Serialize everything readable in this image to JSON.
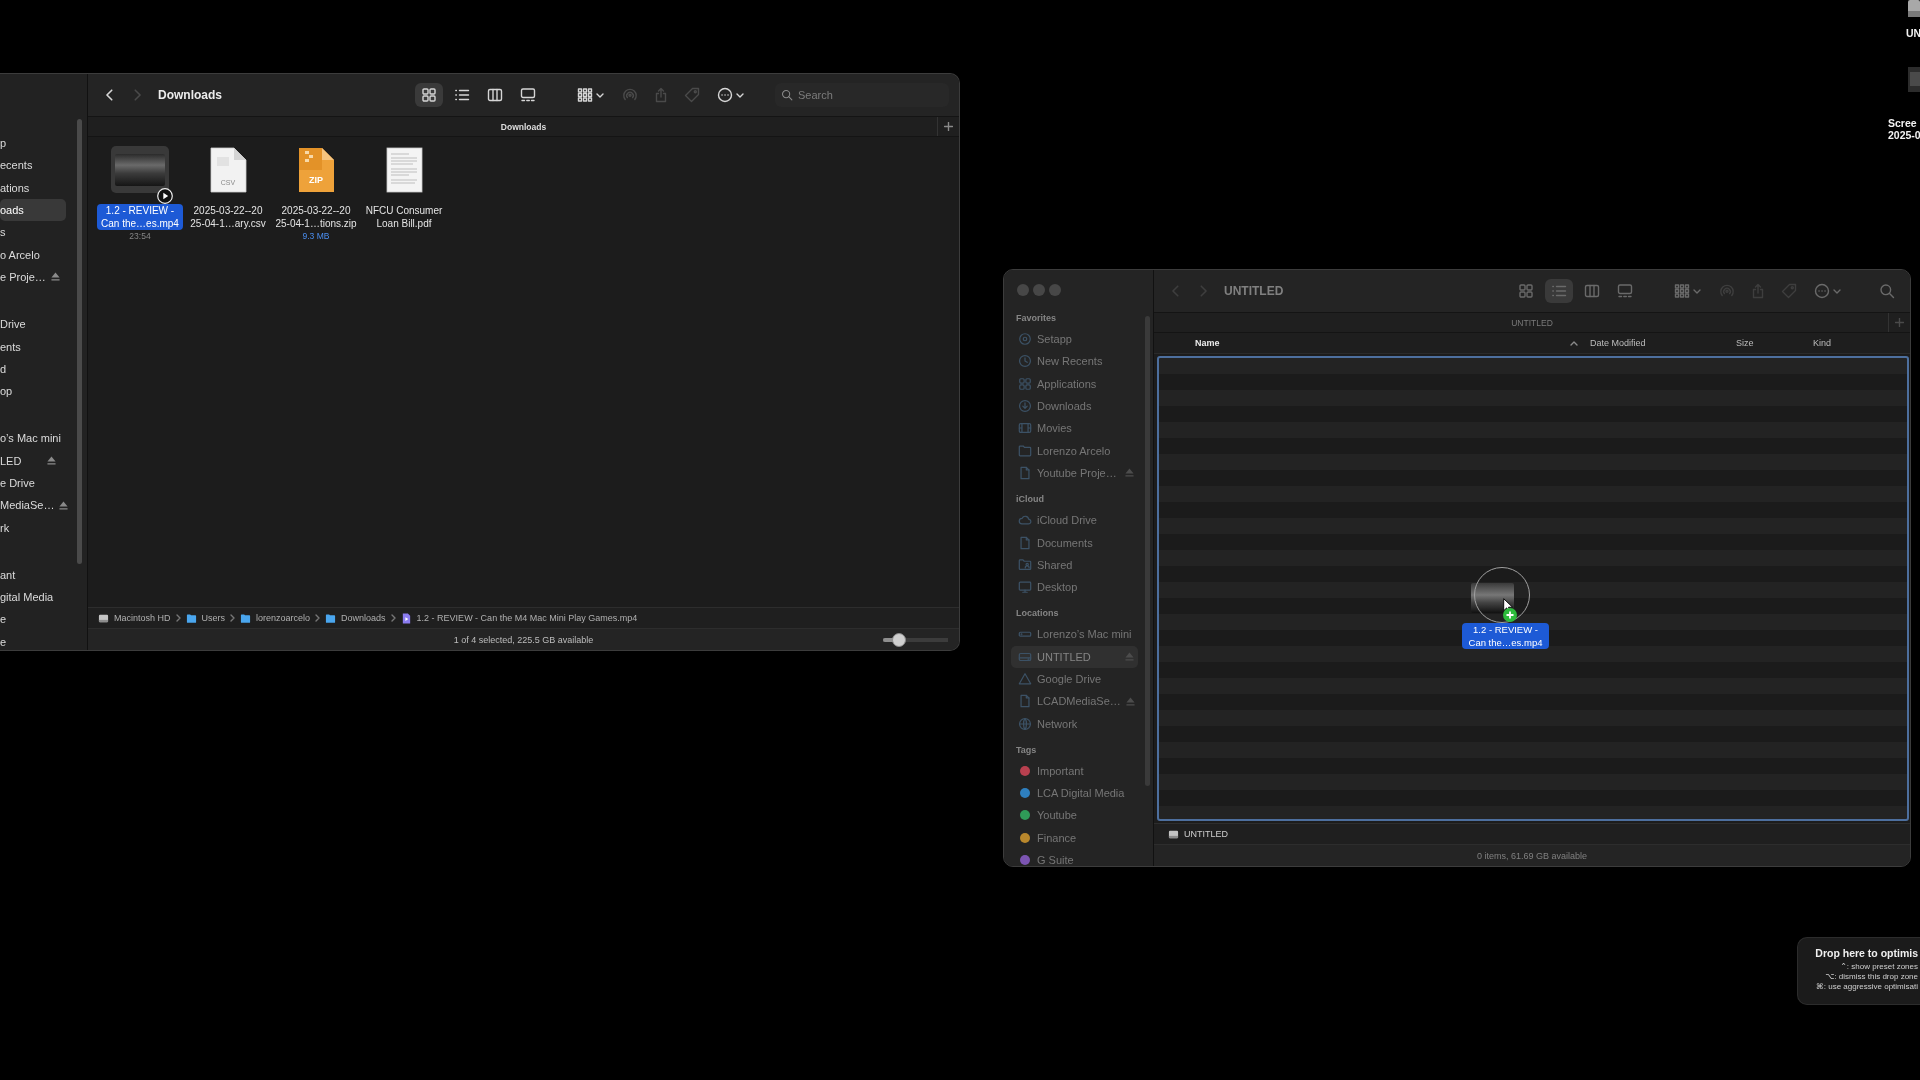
{
  "desktop_icons": [
    {
      "kind": "drive",
      "label_lines": [
        "UN"
      ]
    },
    {
      "kind": "screenshot",
      "label_lines": [
        "Scree",
        "2025-0"
      ]
    }
  ],
  "windows": [
    {
      "kind": "icon_view",
      "active": true,
      "sidebar": {
        "sections": [
          {
            "items": [
              {
                "label": "p",
                "selected": false,
                "eject": false
              },
              {
                "label": "ecents",
                "selected": false,
                "eject": false
              },
              {
                "label": "ations",
                "selected": false,
                "eject": false
              },
              {
                "label": "oads",
                "selected": true,
                "eject": false
              },
              {
                "label": "s",
                "selected": false,
                "eject": false
              },
              {
                "label": "o Arcelo",
                "selected": false,
                "eject": false
              },
              {
                "label": "e Proje…",
                "selected": false,
                "eject": true
              }
            ]
          },
          {
            "items": [
              {
                "label": "Drive",
                "selected": false,
                "eject": false
              },
              {
                "label": "ents",
                "selected": false,
                "eject": false
              },
              {
                "label": "d",
                "selected": false,
                "eject": false
              },
              {
                "label": "op",
                "selected": false,
                "eject": false
              }
            ]
          },
          {
            "items": [
              {
                "label": "o’s Mac mini",
                "selected": false,
                "eject": false
              },
              {
                "label": "LED",
                "selected": false,
                "eject": true
              },
              {
                "label": "e Drive",
                "selected": false,
                "eject": false
              },
              {
                "label": "MediaSe…",
                "selected": false,
                "eject": true
              },
              {
                "label": "rk",
                "selected": false,
                "eject": false
              }
            ]
          },
          {
            "items": [
              {
                "label": "ant",
                "selected": false,
                "eject": false
              },
              {
                "label": "gital Media",
                "selected": false,
                "eject": false
              },
              {
                "label": "e",
                "selected": false,
                "eject": false
              },
              {
                "label": "e",
                "selected": false,
                "eject": false
              }
            ]
          }
        ]
      },
      "toolbar": {
        "nav": [
          {
            "kind": "back",
            "disabled": false
          },
          {
            "kind": "forward",
            "disabled": true
          }
        ],
        "title": "Downloads",
        "view_modes": [
          {
            "kind": "icons",
            "selected": true
          },
          {
            "kind": "list",
            "selected": false
          },
          {
            "kind": "columns",
            "selected": false
          },
          {
            "kind": "gallery",
            "selected": false
          }
        ],
        "actions": [
          {
            "kind": "group",
            "disabled": false
          },
          {
            "kind": "airdrop",
            "disabled": true
          },
          {
            "kind": "share",
            "disabled": true
          },
          {
            "kind": "tag",
            "disabled": true
          },
          {
            "kind": "more",
            "disabled": false
          }
        ],
        "search": {
          "kind": "field",
          "placeholder": "Search"
        }
      },
      "tab_label": "Downloads",
      "files": [
        {
          "kind": "video",
          "name_lines": [
            "1.2 - REVIEW -",
            "Can the…es.mp4"
          ],
          "detail": {
            "kind": "duration",
            "text": "23:54"
          },
          "selected": true
        },
        {
          "kind": "csv",
          "badge": "CSV",
          "name_lines": [
            "2025-03-22--20",
            "25-04-1…ary.csv"
          ],
          "selected": false
        },
        {
          "kind": "zip",
          "badge": "ZIP",
          "name_lines": [
            "2025-03-22--20",
            "25-04-1…tions.zip"
          ],
          "detail": {
            "kind": "size",
            "text": "9.3 MB"
          },
          "selected": false
        },
        {
          "kind": "pdf",
          "name_lines": [
            "NFCU Consumer",
            "Loan Bill.pdf"
          ],
          "selected": false
        }
      ],
      "path": [
        {
          "kind": "disk",
          "label": "Macintosh HD"
        },
        {
          "kind": "folder",
          "label": "Users"
        },
        {
          "kind": "folder",
          "label": "lorenzoarcelo"
        },
        {
          "kind": "folder",
          "label": "Downloads"
        },
        {
          "kind": "video",
          "label": "1.2 - REVIEW - Can the M4 Mac Mini Play Games.mp4"
        }
      ],
      "status": "1 of 4 selected, 225.5 GB available",
      "zoom_slider": {
        "level": 0.25
      }
    },
    {
      "kind": "list_view",
      "active": false,
      "window_buttons": true,
      "sidebar": {
        "sections": [
          {
            "header": "Favorites",
            "items": [
              {
                "kind": "setapp",
                "label": "Setapp",
                "selected": false,
                "eject": false
              },
              {
                "kind": "recents",
                "label": "New Recents",
                "selected": false,
                "eject": false
              },
              {
                "kind": "applications",
                "label": "Applications",
                "selected": false,
                "eject": false
              },
              {
                "kind": "downloads",
                "label": "Downloads",
                "selected": false,
                "eject": false
              },
              {
                "kind": "movies",
                "label": "Movies",
                "selected": false,
                "eject": false
              },
              {
                "kind": "folder",
                "label": "Lorenzo Arcelo",
                "selected": false,
                "eject": false
              },
              {
                "kind": "document",
                "label": "Youtube Proje…",
                "selected": false,
                "eject": true
              }
            ]
          },
          {
            "header": "iCloud",
            "items": [
              {
                "kind": "cloud",
                "label": "iCloud Drive",
                "selected": false,
                "eject": false
              },
              {
                "kind": "document",
                "label": "Documents",
                "selected": false,
                "eject": false
              },
              {
                "kind": "shared",
                "label": "Shared",
                "selected": false,
                "eject": false
              },
              {
                "kind": "desktop",
                "label": "Desktop",
                "selected": false,
                "eject": false
              }
            ]
          },
          {
            "header": "Locations",
            "items": [
              {
                "kind": "computer",
                "label": "Lorenzo’s Mac mini",
                "selected": false,
                "eject": false
              },
              {
                "kind": "drive",
                "label": "UNTITLED",
                "selected": true,
                "eject": true
              },
              {
                "kind": "gdrive",
                "label": "Google Drive",
                "selected": false,
                "eject": false
              },
              {
                "kind": "document",
                "label": "LCADMediaSe…",
                "selected": false,
                "eject": true
              },
              {
                "kind": "network",
                "label": "Network",
                "selected": false,
                "eject": false
              }
            ]
          },
          {
            "header": "Tags",
            "items": [
              {
                "kind": "tag",
                "label": "Important",
                "color": "#b8404f",
                "selected": false,
                "eject": false
              },
              {
                "kind": "tag",
                "label": "LCA Digital Media",
                "color": "#2e7fbf",
                "selected": false,
                "eject": false
              },
              {
                "kind": "tag",
                "label": "Youtube",
                "color": "#2f9a58",
                "selected": false,
                "eject": false
              },
              {
                "kind": "tag",
                "label": "Finance",
                "color": "#b8872c",
                "selected": false,
                "eject": false
              },
              {
                "kind": "tag",
                "label": "G Suite",
                "color": "#7c55b2",
                "selected": false,
                "eject": false
              }
            ]
          }
        ]
      },
      "toolbar": {
        "nav": [
          {
            "kind": "back",
            "disabled": true
          },
          {
            "kind": "forward",
            "disabled": true
          }
        ],
        "title": "UNTITLED",
        "view_modes": [
          {
            "kind": "icons",
            "selected": false
          },
          {
            "kind": "list",
            "selected": true
          },
          {
            "kind": "columns",
            "selected": false
          },
          {
            "kind": "gallery",
            "selected": false
          }
        ],
        "actions": [
          {
            "kind": "group",
            "disabled": false
          },
          {
            "kind": "airdrop",
            "disabled": true
          },
          {
            "kind": "share",
            "disabled": true
          },
          {
            "kind": "tag",
            "disabled": true
          },
          {
            "kind": "more",
            "disabled": false
          }
        ],
        "search": {
          "kind": "button"
        }
      },
      "tab_label": "UNTITLED",
      "columns": [
        {
          "label": "Name",
          "sorted": true
        },
        {
          "label": "Date Modified",
          "sorted": false
        },
        {
          "label": "Size",
          "sorted": false
        },
        {
          "label": "Kind",
          "sorted": false
        }
      ],
      "drop_target": true,
      "drag_item": {
        "name_lines": [
          "1.2 - REVIEW -",
          "Can the…es.mp4"
        ]
      },
      "path": [
        {
          "kind": "disk",
          "label": "UNTITLED"
        }
      ],
      "status": "0 items, 61.69 GB available"
    }
  ],
  "drop_zone": {
    "title": "Drop here to optimis",
    "hints": [
      "⌃: show preset zones",
      "⌥: dismiss this drop zone",
      "⌘: use aggressive optimisati"
    ]
  }
}
